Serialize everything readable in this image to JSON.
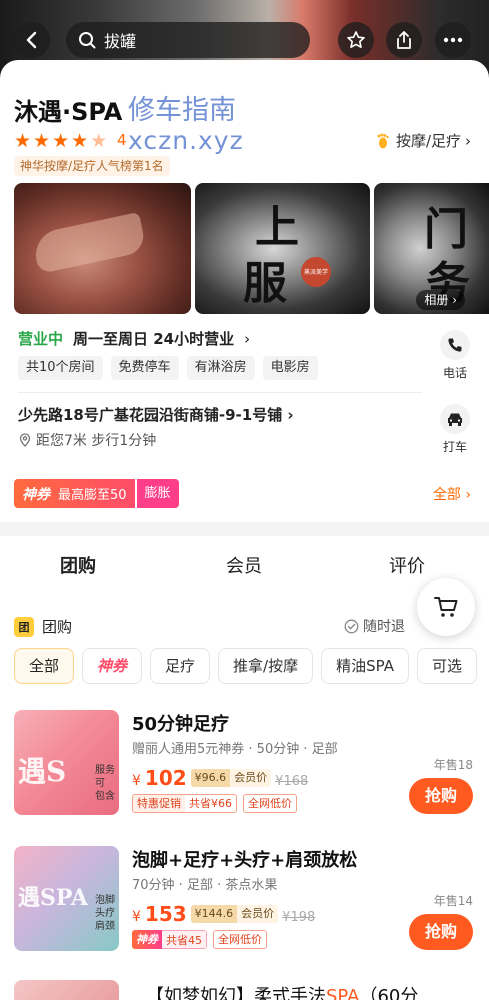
{
  "header": {
    "search_query": "拔罐"
  },
  "shop": {
    "name": "沐遇·SPA",
    "rating": "4",
    "category": "按摩/足疗",
    "rank": "神华按摩/足疗人气榜第1名",
    "watermark_line1": "修车指南",
    "watermark_line2": "xczn.xyz"
  },
  "photos": {
    "char1": "上",
    "char2": "服",
    "char3": "门",
    "char4": "务",
    "seal": "蒸派美学",
    "album_label": "相册"
  },
  "info": {
    "status": "营业中",
    "hours": "周一至周日 24小时营业",
    "chips": [
      "共10个房间",
      "免费停车",
      "有淋浴房",
      "电影房"
    ],
    "phone_label": "电话",
    "address": "少先路18号广基花园沿街商铺-9-1号铺",
    "distance": "距您7米 步行1分钟",
    "taxi_label": "打车"
  },
  "coupon": {
    "brand": "神券",
    "text": "最高膨至50",
    "expand": "膨胀",
    "all": "全部"
  },
  "tabs": [
    "团购",
    "会员",
    "评价"
  ],
  "groupbuy": {
    "icon_text": "团",
    "title": "团购",
    "refund": "随时退",
    "filters": [
      "全部",
      "神券",
      "足疗",
      "推拿/按摩",
      "精油SPA",
      "可选"
    ]
  },
  "deals": [
    {
      "title": "50分钟足疗",
      "sub": "赠丽人通用5元神券 · 50分钟 · 足部",
      "yen": "¥",
      "price": "102",
      "member_price": "¥96.6",
      "member_label": "会员价",
      "orig": "¥168",
      "tag_a": "特惠促销",
      "tag_b": "共省¥66",
      "tag_low": "全网低价",
      "sold": "年售18",
      "buy": "抢购",
      "img_text": "遇S",
      "img_list": [
        "服务",
        "可",
        "包含"
      ]
    },
    {
      "title": "泡脚+足疗+头疗+肩颈放松",
      "sub": "70分钟 · 足部 · 茶点水果",
      "yen": "¥",
      "price": "153",
      "member_price": "¥144.6",
      "member_label": "会员价",
      "orig": "¥198",
      "tag_a": "神券",
      "tag_b": "共省45",
      "tag_low": "全网低价",
      "sold": "年售14",
      "buy": "抢购",
      "img_text": "遇SPA",
      "img_list": [
        "泡脚",
        "头疗",
        "肩颈"
      ]
    }
  ],
  "peek": {
    "pre": "【如梦如幻】柔式手法",
    "hl": "SPA",
    "post": "（60分"
  }
}
